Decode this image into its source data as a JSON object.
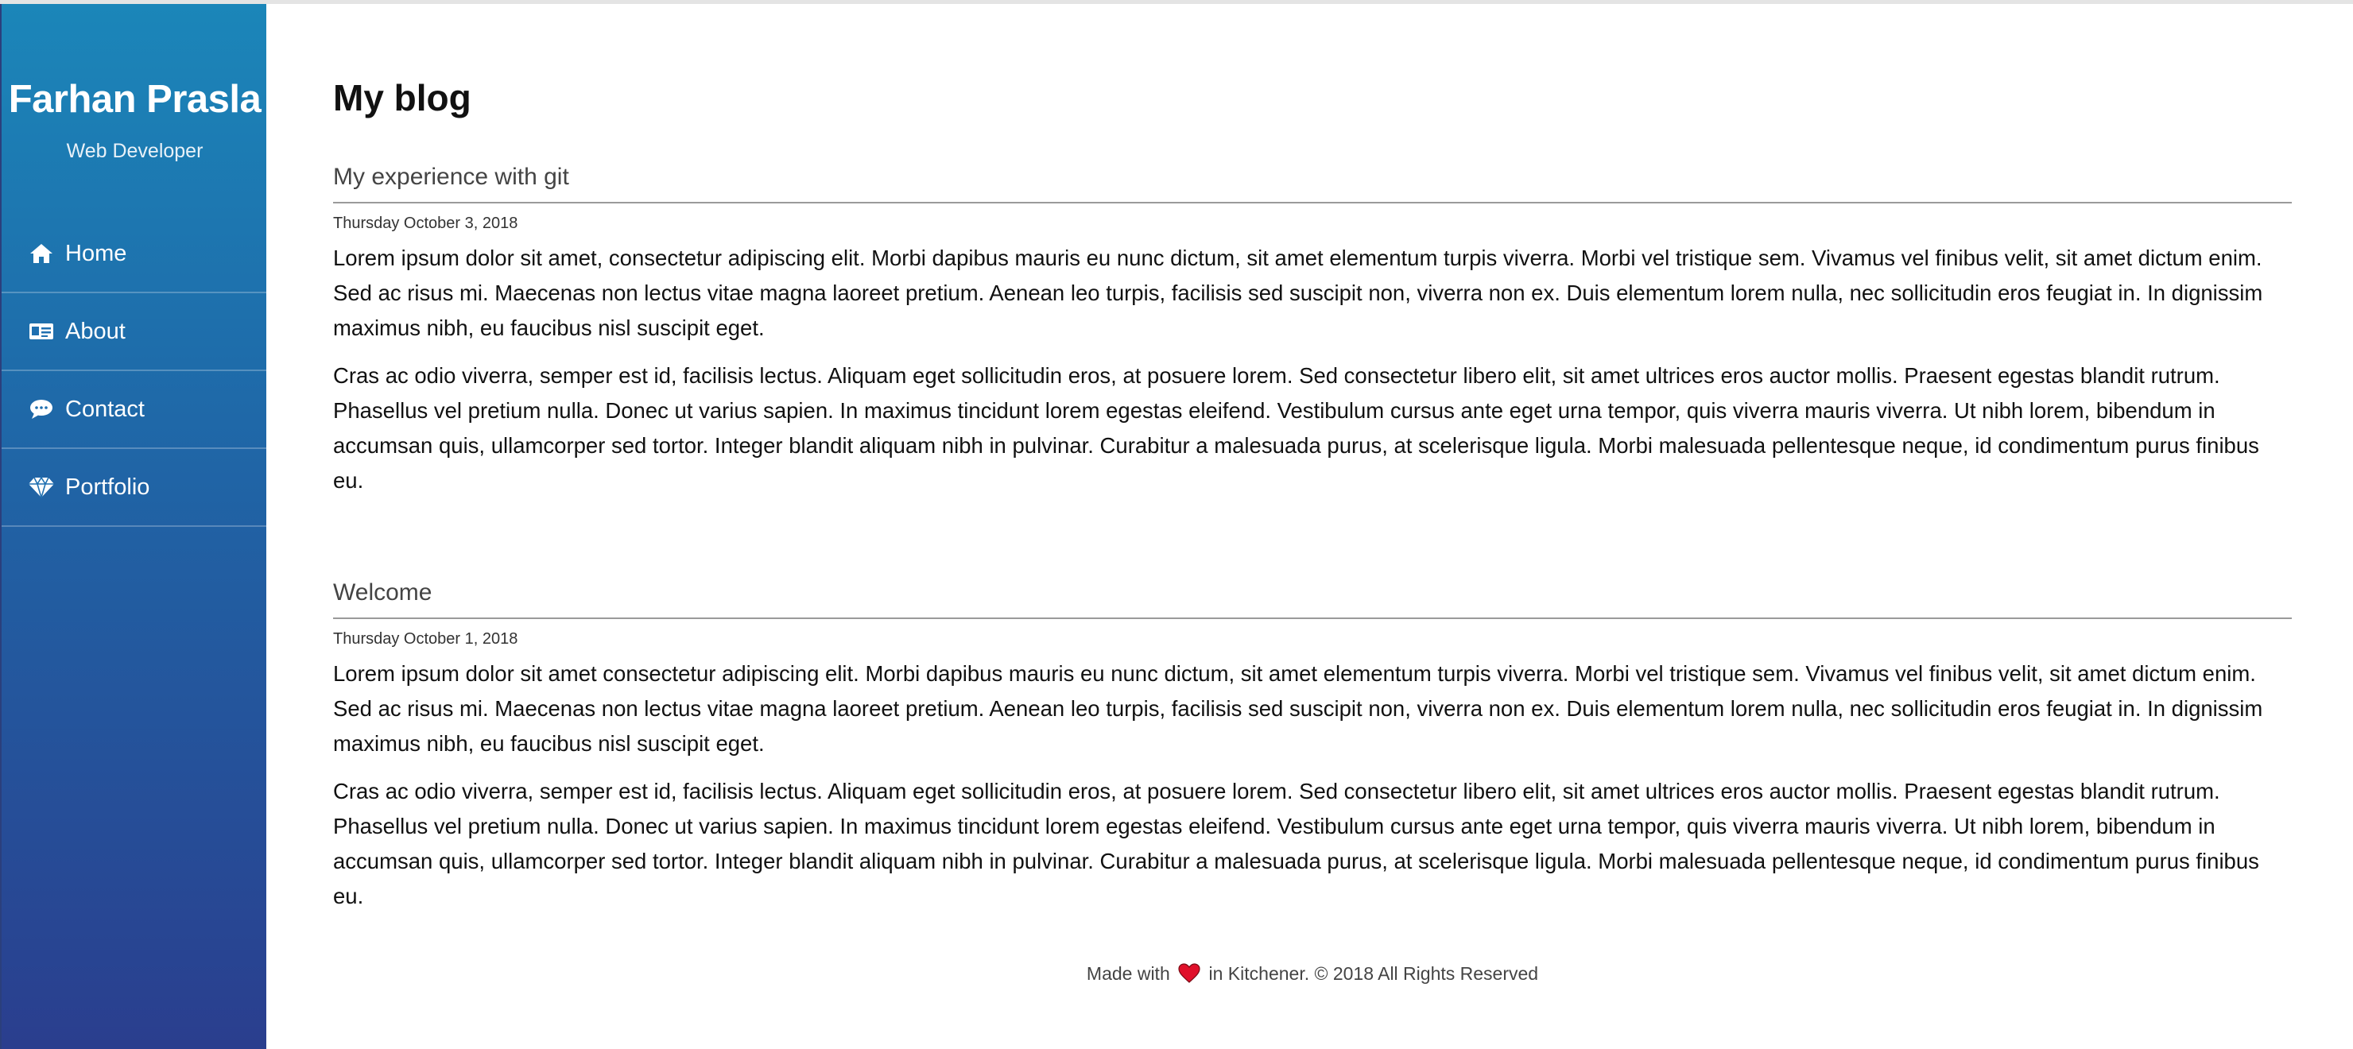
{
  "sidebar": {
    "name": "Farhan Prasla",
    "role": "Web Developer",
    "items": [
      {
        "label": "Home",
        "icon": "home-icon"
      },
      {
        "label": "About",
        "icon": "id-card-icon"
      },
      {
        "label": "Contact",
        "icon": "chat-bubble-icon"
      },
      {
        "label": "Portfolio",
        "icon": "diamond-icon"
      }
    ]
  },
  "main": {
    "title": "My blog",
    "posts": [
      {
        "title": "My experience with git",
        "date": "Thursday October 3, 2018",
        "paragraphs": [
          "Lorem ipsum dolor sit amet, consectetur adipiscing elit. Morbi dapibus mauris eu nunc dictum, sit amet elementum turpis viverra. Morbi vel tristique sem. Vivamus vel finibus velit, sit amet dictum enim. Sed ac risus mi. Maecenas non lectus vitae magna laoreet pretium. Aenean leo turpis, facilisis sed suscipit non, viverra non ex. Duis elementum lorem nulla, nec sollicitudin eros feugiat in. In dignissim maximus nibh, eu faucibus nisl suscipit eget.",
          "Cras ac odio viverra, semper est id, facilisis lectus. Aliquam eget sollicitudin eros, at posuere lorem. Sed consectetur libero elit, sit amet ultrices eros auctor mollis. Praesent egestas blandit rutrum. Phasellus vel pretium nulla. Donec ut varius sapien. In maximus tincidunt lorem egestas eleifend. Vestibulum cursus ante eget urna tempor, quis viverra mauris viverra. Ut nibh lorem, bibendum in accumsan quis, ullamcorper sed tortor. Integer blandit aliquam nibh in pulvinar. Curabitur a malesuada purus, at scelerisque ligula. Morbi malesuada pellentesque neque, id condimentum purus finibus eu."
        ]
      },
      {
        "title": "Welcome",
        "date": "Thursday October 1, 2018",
        "paragraphs": [
          "Lorem ipsum dolor sit amet consectetur adipiscing elit. Morbi dapibus mauris eu nunc dictum, sit amet elementum turpis viverra. Morbi vel tristique sem. Vivamus vel finibus velit, sit amet dictum enim. Sed ac risus mi. Maecenas non lectus vitae magna laoreet pretium. Aenean leo turpis, facilisis sed suscipit non, viverra non ex. Duis elementum lorem nulla, nec sollicitudin eros feugiat in. In dignissim maximus nibh, eu faucibus nisl suscipit eget.",
          "Cras ac odio viverra, semper est id, facilisis lectus. Aliquam eget sollicitudin eros, at posuere lorem. Sed consectetur libero elit, sit amet ultrices eros auctor mollis. Praesent egestas blandit rutrum. Phasellus vel pretium nulla. Donec ut varius sapien. In maximus tincidunt lorem egestas eleifend. Vestibulum cursus ante eget urna tempor, quis viverra mauris viverra. Ut nibh lorem, bibendum in accumsan quis, ullamcorper sed tortor. Integer blandit aliquam nibh in pulvinar. Curabitur a malesuada purus, at scelerisque ligula. Morbi malesuada pellentesque neque, id condimentum purus finibus eu."
        ]
      }
    ]
  },
  "footer": {
    "before": "Made with",
    "after": "in Kitchener. © 2018 All Rights Reserved",
    "icon": "heart-icon"
  },
  "colors": {
    "sidebar_top": "#1b86b9",
    "sidebar_bottom": "#2a3e8e",
    "heart": "#e0102a"
  }
}
